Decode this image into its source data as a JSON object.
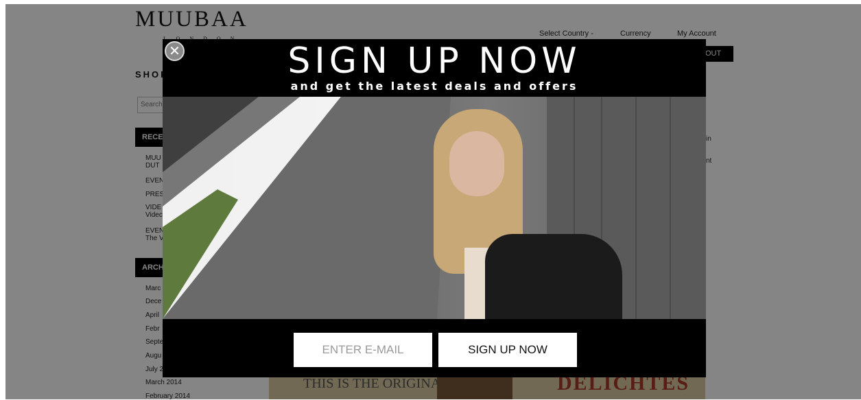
{
  "site": {
    "logo": "MUUBAA",
    "logo_sub": "L O N D O N",
    "top_nav": {
      "country": "Select Country -",
      "currency": "Currency",
      "account": "My Account"
    },
    "checkout_fragment": "OUT",
    "shop_heading_fragment": "SHOP",
    "search_fragment": "Search",
    "sidebar": {
      "recent_heading": "RECE",
      "recent_items": [
        "MUU DUT",
        "EVEN",
        "PRES",
        "VIDE Videc",
        "EVEN The V"
      ],
      "archive_heading": "ARCH",
      "archive_items": [
        "Marc",
        "Dece",
        "April",
        "Febr",
        "Septe",
        "Augu",
        "July 2",
        "March 2014",
        "February 2014"
      ]
    },
    "right_fragments": [
      "in",
      "nt"
    ],
    "banner_text": "THIS IS THE ORIGINAL",
    "banner_text_2": "DELICHTES"
  },
  "modal": {
    "title": "SIGN UP NOW",
    "subtitle": "and get the latest deals and offers",
    "close_glyph": "✕",
    "email_placeholder": "ENTER E-MAIL",
    "submit_label": "SIGN UP NOW"
  }
}
